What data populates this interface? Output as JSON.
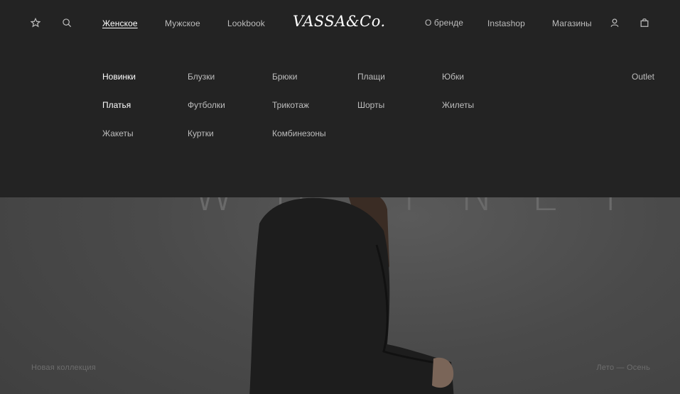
{
  "header": {
    "nav_left": [
      "Женское",
      "Мужское",
      "Lookbook"
    ],
    "logo": "VASSA&Co.",
    "nav_right": [
      "О бренде",
      "Instashop",
      "Магазины"
    ],
    "icons": [
      "star-icon",
      "search-icon",
      "user-icon",
      "bag-icon"
    ]
  },
  "submenu": {
    "columns": [
      [
        "Новинки",
        "Платья",
        "Жакеты"
      ],
      [
        "Блузки",
        "Футболки",
        "Куртки"
      ],
      [
        "Брюки",
        "Трикотаж",
        "Комбинезоны"
      ],
      [
        "Плащи",
        "Шорты"
      ],
      [
        "Юбки",
        "Жилеты"
      ]
    ],
    "outlet": "Outlet"
  },
  "hero": {
    "word": "WHITNEY",
    "caption_left": "Новая коллекция",
    "caption_right": "Лето — Осень"
  },
  "colors": {
    "menu_bg": "#232323",
    "hero_bg": "#4a4a4a",
    "text_muted": "#bdbdbd",
    "text_active": "#ffffff"
  }
}
